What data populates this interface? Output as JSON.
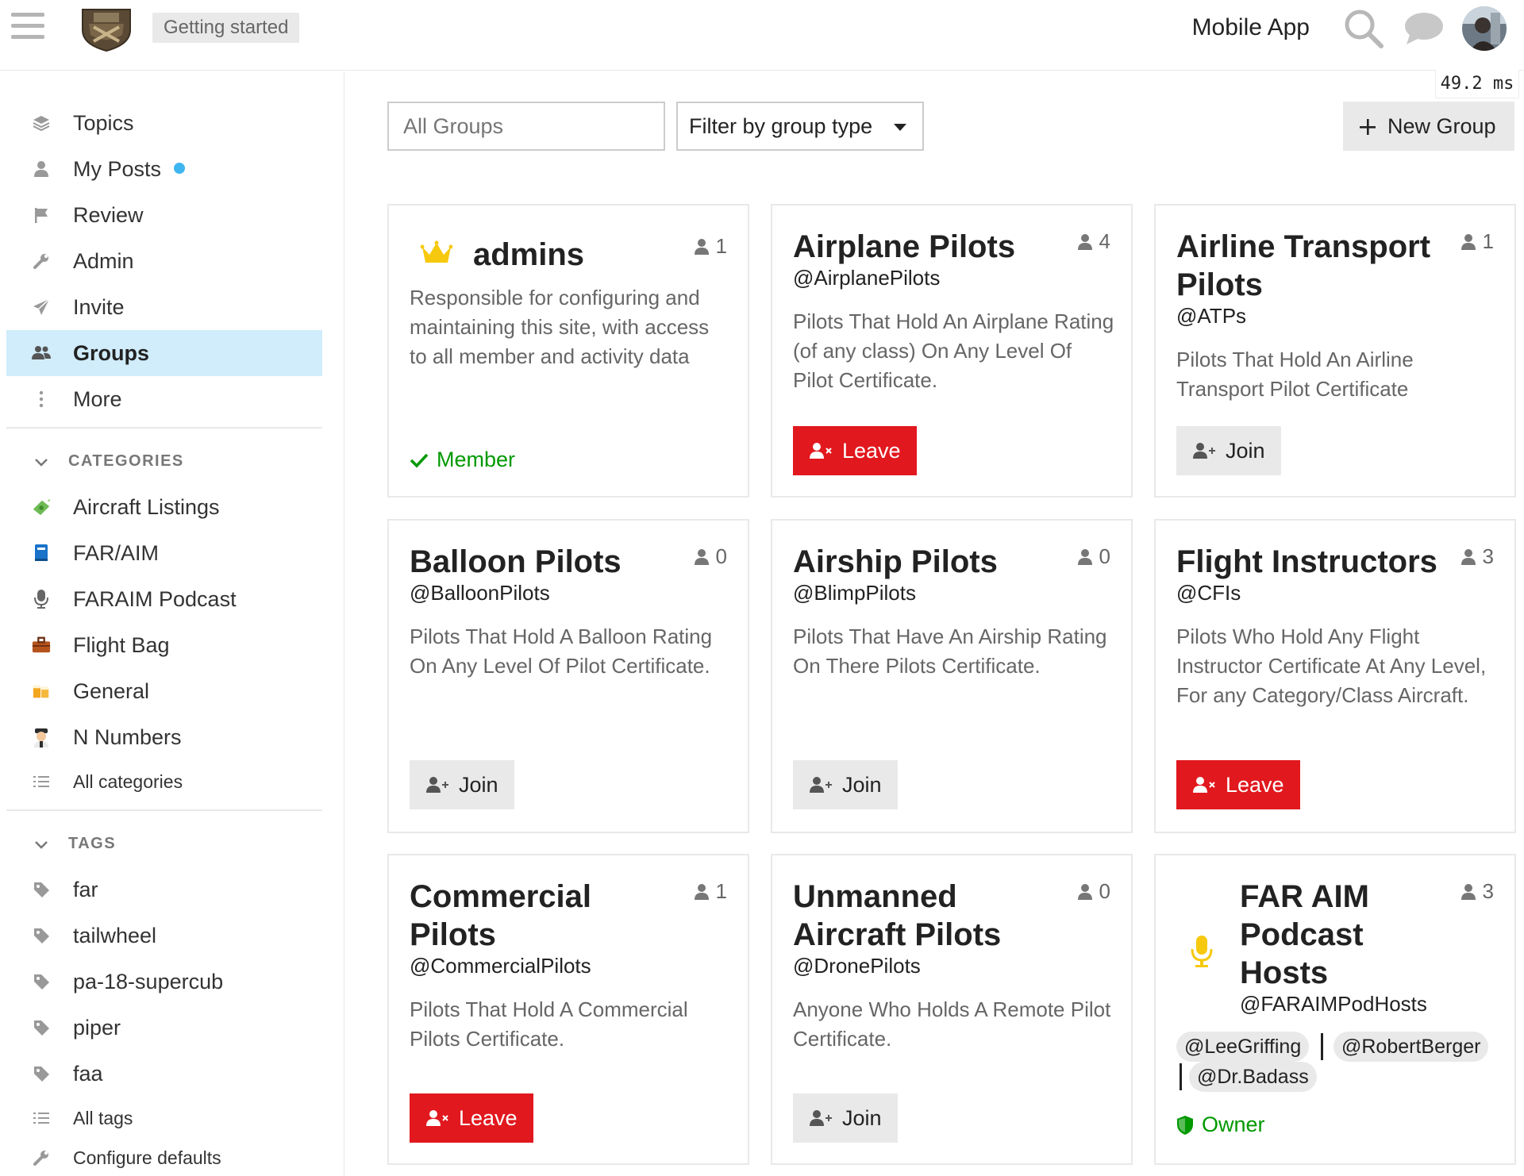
{
  "header": {
    "getting_started": "Getting started",
    "mobile_app": "Mobile App",
    "timing": "49.2 ms"
  },
  "sidebar": {
    "nav": [
      {
        "label": "Topics",
        "icon": "layers-icon"
      },
      {
        "label": "My Posts",
        "icon": "user-icon",
        "has_dot": true
      },
      {
        "label": "Review",
        "icon": "flag-icon"
      },
      {
        "label": "Admin",
        "icon": "wrench-icon"
      },
      {
        "label": "Invite",
        "icon": "paper-plane-icon"
      },
      {
        "label": "Groups",
        "icon": "users-icon",
        "active": true
      },
      {
        "label": "More",
        "icon": "ellipsis-vertical-icon"
      }
    ],
    "categories_title": "CATEGORIES",
    "categories": [
      {
        "label": "Aircraft Listings",
        "icon": "money-icon"
      },
      {
        "label": "FAR/AIM",
        "icon": "book-icon"
      },
      {
        "label": "FARAIM Podcast",
        "icon": "microphone-icon"
      },
      {
        "label": "Flight Bag",
        "icon": "briefcase-icon"
      },
      {
        "label": "General",
        "icon": "beer-icon"
      },
      {
        "label": "N Numbers",
        "icon": "pilot-icon"
      }
    ],
    "all_categories": "All categories",
    "tags_title": "TAGS",
    "tags": [
      "far",
      "tailwheel",
      "pa-18-supercub",
      "piper",
      "faa"
    ],
    "all_tags": "All tags",
    "configure_defaults": "Configure defaults"
  },
  "toolbar": {
    "search_placeholder": "All Groups",
    "filter_label": "Filter by group type",
    "new_group_label": "New Group"
  },
  "groups": [
    {
      "name_lines": [
        "admins"
      ],
      "handle": "",
      "count": "1",
      "desc": "Responsible for configuring and maintaining this site, with access to all member and activity data",
      "action": "status",
      "status_label": "Member"
    },
    {
      "name_lines": [
        "Airplane Pilots"
      ],
      "handle": "@AirplanePilots",
      "count": "4",
      "desc": "Pilots That Hold An Airplane Rating (of any class) On Any Level Of Pilot Certificate.",
      "action": "leave",
      "action_label": "Leave"
    },
    {
      "name_lines": [
        "Airline Transport",
        "Pilots"
      ],
      "handle": "@ATPs",
      "count": "1",
      "desc": "Pilots That Hold An Airline Transport Pilot Certificate",
      "action": "join",
      "action_label": "Join"
    },
    {
      "name_lines": [
        "Balloon Pilots"
      ],
      "handle": "@BalloonPilots",
      "count": "0",
      "desc": "Pilots That Hold A Balloon Rating On Any Level Of Pilot Certificate.",
      "action": "join",
      "action_label": "Join"
    },
    {
      "name_lines": [
        "Airship Pilots"
      ],
      "handle": "@BlimpPilots",
      "count": "0",
      "desc": "Pilots That Have An Airship Rating On There Pilots Certificate.",
      "action": "join",
      "action_label": "Join"
    },
    {
      "name_lines": [
        "Flight Instructors"
      ],
      "handle": "@CFIs",
      "count": "3",
      "desc": "Pilots Who Hold Any Flight Instructor Certificate At Any Level, For any Category/Class Aircraft.",
      "action": "leave",
      "action_label": "Leave"
    },
    {
      "name_lines": [
        "Commercial",
        "Pilots"
      ],
      "handle": "@CommercialPilots",
      "count": "1",
      "desc": "Pilots That Hold A Commercial Pilots Certificate.",
      "action": "leave",
      "action_label": "Leave"
    },
    {
      "name_lines": [
        "Unmanned",
        "Aircraft Pilots"
      ],
      "handle": "@DronePilots",
      "count": "0",
      "desc": "Anyone Who Holds A Remote Pilot Certificate.",
      "action": "join",
      "action_label": "Join"
    },
    {
      "name_lines": [
        "FAR AIM",
        "Podcast",
        "Hosts"
      ],
      "handle": "@FARAIMPodHosts",
      "count": "3",
      "owners": [
        "@LeeGriffing",
        "@RobertBerger",
        "@Dr.Badass"
      ],
      "action": "owner",
      "status_label": "Owner"
    }
  ],
  "colors": {
    "active_nav": "#d1ecfa",
    "leave": "#e1181e",
    "member": "#009900",
    "dot": "#3fb6f0"
  }
}
